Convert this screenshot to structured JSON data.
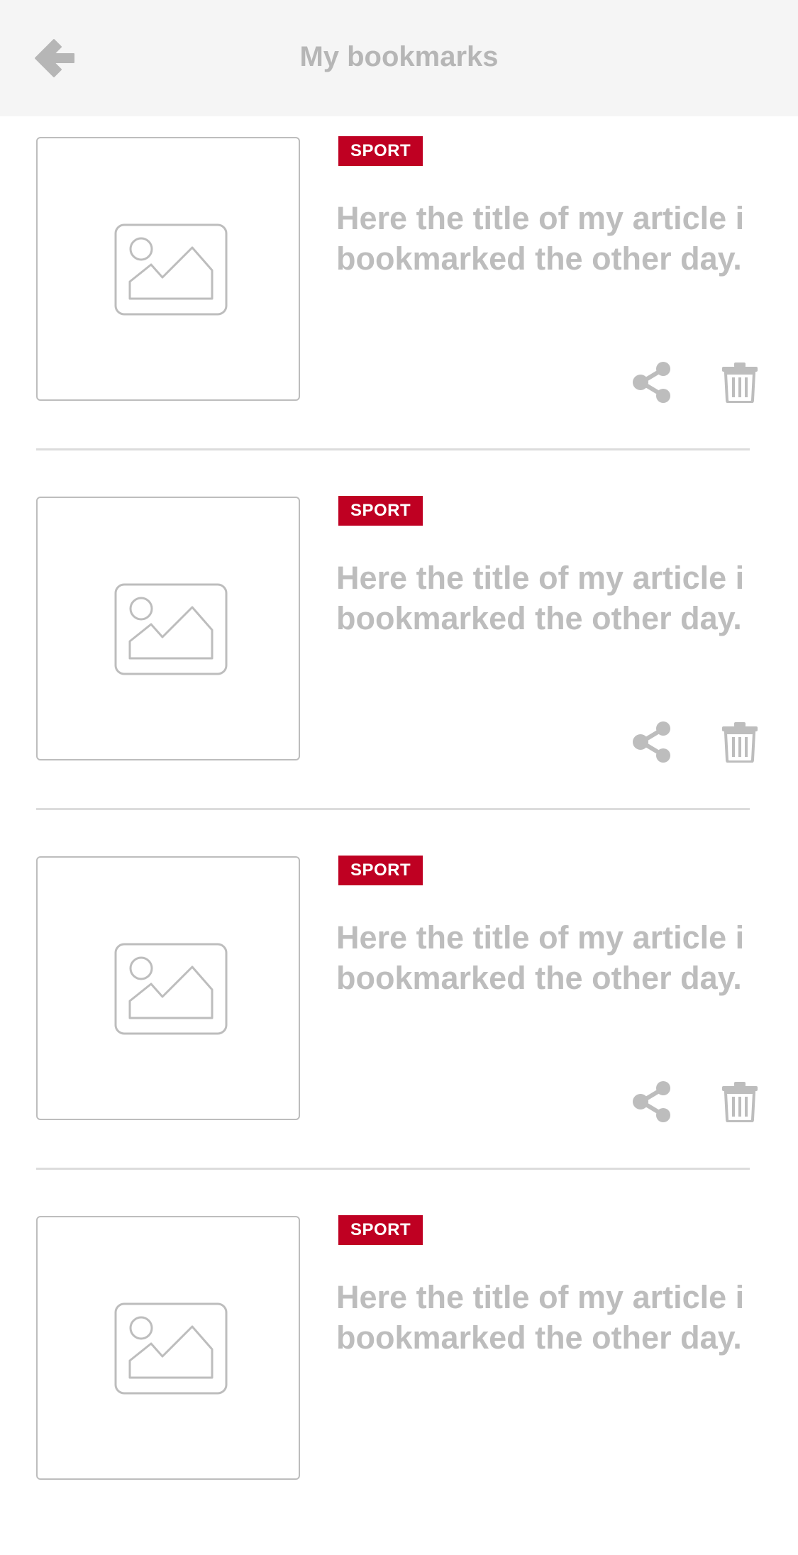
{
  "header": {
    "title": "My bookmarks",
    "back_icon": "arrow-left-icon",
    "background": "#f5f5f5"
  },
  "colors": {
    "accent": "#bf0022",
    "muted_text": "#bdbdbd"
  },
  "bookmarks": [
    {
      "category": "SPORT",
      "title": "Here the title of my article i bookmarked the other day.",
      "thumbnail_icon": "image-placeholder-icon",
      "actions": [
        "share-icon",
        "trash-icon"
      ]
    },
    {
      "category": "SPORT",
      "title": "Here the title of my article i bookmarked the other day.",
      "thumbnail_icon": "image-placeholder-icon",
      "actions": [
        "share-icon",
        "trash-icon"
      ]
    },
    {
      "category": "SPORT",
      "title": "Here the title of my article i bookmarked the other day.",
      "thumbnail_icon": "image-placeholder-icon",
      "actions": [
        "share-icon",
        "trash-icon"
      ]
    },
    {
      "category": "SPORT",
      "title": "Here the title of my article i bookmarked the other day.",
      "thumbnail_icon": "image-placeholder-icon",
      "actions": [
        "share-icon",
        "trash-icon"
      ]
    }
  ]
}
